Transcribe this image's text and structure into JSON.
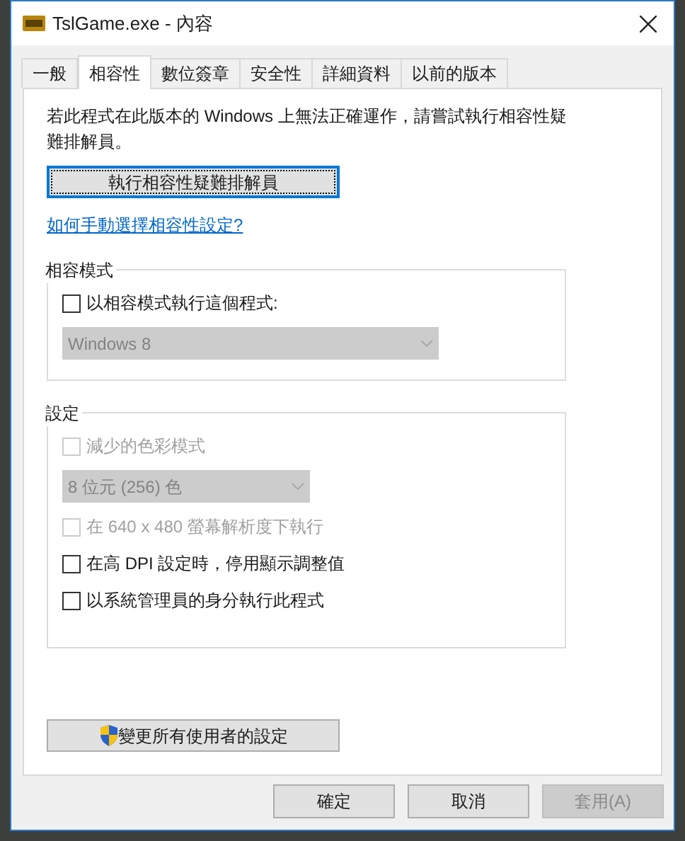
{
  "window": {
    "title": "TslGame.exe - 內容"
  },
  "tabs": [
    {
      "label": "一般",
      "selected": false
    },
    {
      "label": "相容性",
      "selected": true
    },
    {
      "label": "數位簽章",
      "selected": false
    },
    {
      "label": "安全性",
      "selected": false
    },
    {
      "label": "詳細資料",
      "selected": false
    },
    {
      "label": "以前的版本",
      "selected": false
    }
  ],
  "description": "若此程式在此版本的 Windows 上無法正確運作，請嘗試執行相容性疑難排解員。",
  "troubleshooter_button": {
    "label": "執行相容性疑難排解員",
    "focused": true
  },
  "help_link": "如何手動選擇相容性設定?",
  "groups": [
    {
      "title": "相容模式",
      "items": [
        {
          "kind": "checkbox",
          "label": "以相容模式執行這個程式:",
          "checked": false,
          "disabled": false
        },
        {
          "kind": "dropdown",
          "value": "Windows 8",
          "disabled": true,
          "wide": true
        }
      ]
    },
    {
      "title": "設定",
      "items": [
        {
          "kind": "checkbox",
          "label": "減少的色彩模式",
          "checked": false,
          "disabled": true
        },
        {
          "kind": "dropdown",
          "value": "8 位元 (256) 色",
          "disabled": true,
          "wide": false
        },
        {
          "kind": "checkbox",
          "label": "在 640 x 480 螢幕解析度下執行",
          "checked": false,
          "disabled": true
        },
        {
          "kind": "checkbox",
          "label": "在高 DPI 設定時，停用顯示調整值",
          "checked": false,
          "disabled": false
        },
        {
          "kind": "checkbox",
          "label": "以系統管理員的身分執行此程式",
          "checked": false,
          "disabled": false
        }
      ]
    }
  ],
  "change_all_users_button": {
    "label": "變更所有使用者的設定"
  },
  "footer_buttons": [
    {
      "label": "確定",
      "disabled": false
    },
    {
      "label": "取消",
      "disabled": false
    },
    {
      "label": "套用(A)",
      "disabled": true
    }
  ]
}
